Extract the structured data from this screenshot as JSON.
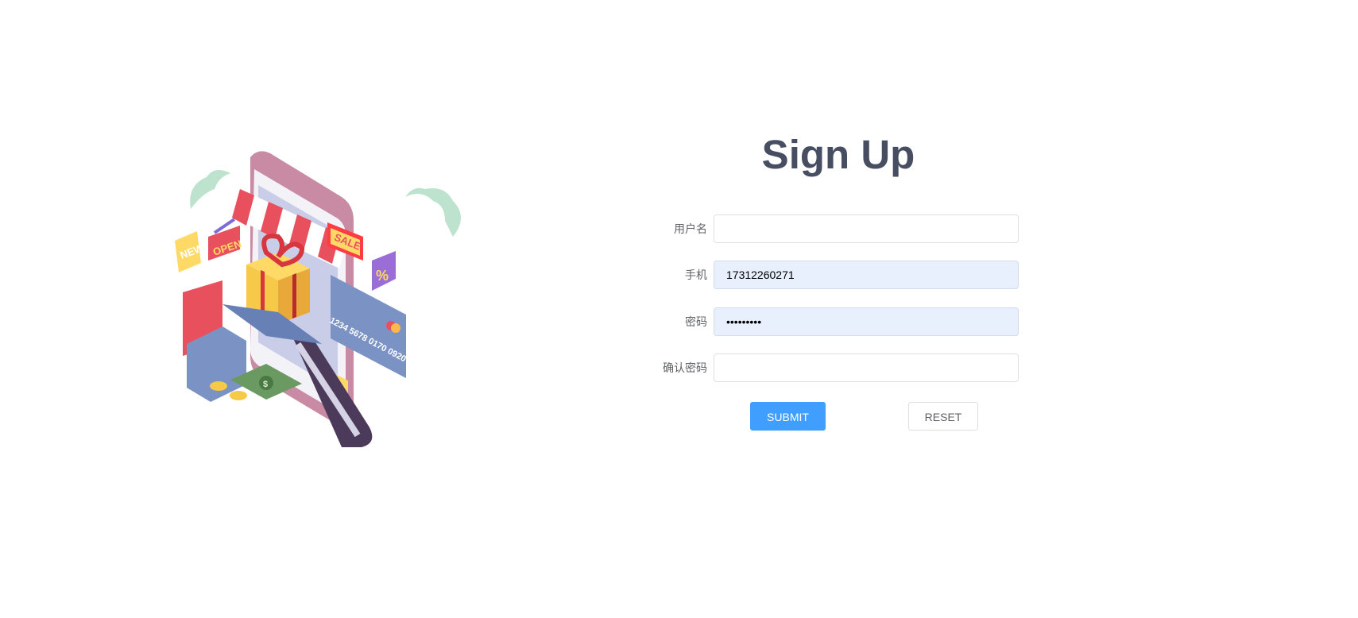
{
  "form": {
    "title": "Sign Up",
    "fields": [
      {
        "label": "用户名",
        "value": "",
        "type": "text"
      },
      {
        "label": "手机",
        "value": "17312260271",
        "type": "text"
      },
      {
        "label": "密码",
        "value": "•••••••••",
        "type": "password"
      },
      {
        "label": "确认密码",
        "value": "",
        "type": "password"
      }
    ],
    "submit_label": "SUBMIT",
    "reset_label": "RESET"
  },
  "illustration": {
    "sign_new": "NEW",
    "sign_open": "OPEN",
    "sign_sale": "SALE",
    "badge_percent": "%",
    "card_number": "1234 5678 0170 0920",
    "coin_symbol": "$"
  },
  "colors": {
    "accent": "#409eff",
    "title": "#474e61",
    "autofill": "#e8f0fe"
  }
}
